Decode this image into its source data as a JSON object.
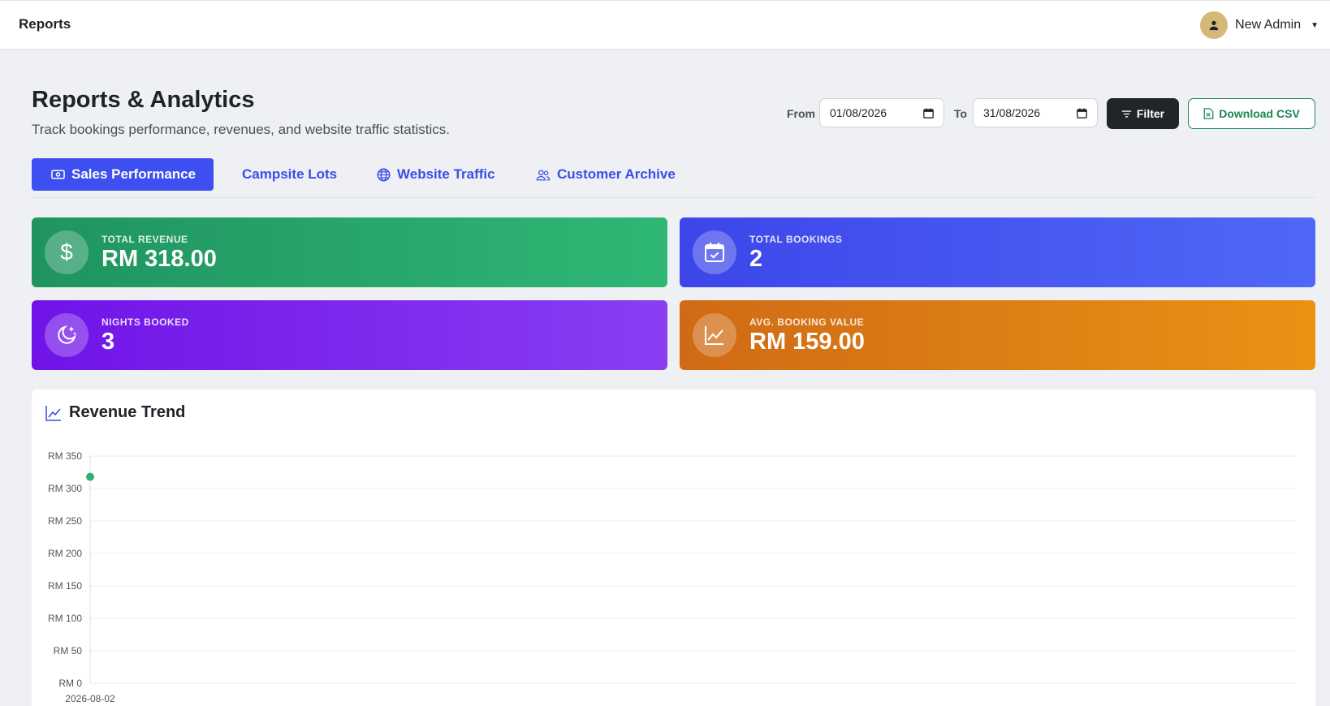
{
  "topbar": {
    "title": "Reports",
    "user_name": "New Admin"
  },
  "header": {
    "title": "Reports & Analytics",
    "subtitle": "Track bookings performance, revenues, and website traffic statistics."
  },
  "filters": {
    "from_label": "From",
    "from_value": "01/08/2026",
    "to_label": "To",
    "to_value": "31/08/2026",
    "filter_label": "Filter",
    "download_label": "Download CSV"
  },
  "tabs": [
    {
      "label": "Sales Performance",
      "active": true,
      "icon": "cash-icon"
    },
    {
      "label": "Campsite Lots",
      "active": false,
      "icon": ""
    },
    {
      "label": "Website Traffic",
      "active": false,
      "icon": "globe-icon"
    },
    {
      "label": "Customer Archive",
      "active": false,
      "icon": "users-icon"
    }
  ],
  "stats": {
    "total_revenue": {
      "label": "TOTAL REVENUE",
      "value": "RM 318.00",
      "icon": "dollar-icon",
      "color": "#1f9460"
    },
    "total_bookings": {
      "label": "TOTAL BOOKINGS",
      "value": "2",
      "icon": "calendar-check-icon",
      "color": "#3d46ea"
    },
    "nights_booked": {
      "label": "NIGHTS BOOKED",
      "value": "3",
      "icon": "moon-stars-icon",
      "color": "#7013e8"
    },
    "avg_booking": {
      "label": "AVG. BOOKING VALUE",
      "value": "RM 159.00",
      "icon": "graph-up-icon",
      "color": "#d06a15"
    }
  },
  "revenue_panel": {
    "title": "Revenue Trend"
  },
  "chart_data": {
    "type": "line",
    "title": "",
    "xlabel": "",
    "ylabel": "",
    "x": [
      "2026-08-02"
    ],
    "series": [
      {
        "values": [
          318
        ],
        "color": "#2ab374"
      }
    ],
    "ylim": [
      0,
      350
    ],
    "y_ticks": [
      0,
      50,
      100,
      150,
      200,
      250,
      300,
      350
    ],
    "y_tick_prefix": "RM ",
    "grid": true
  }
}
